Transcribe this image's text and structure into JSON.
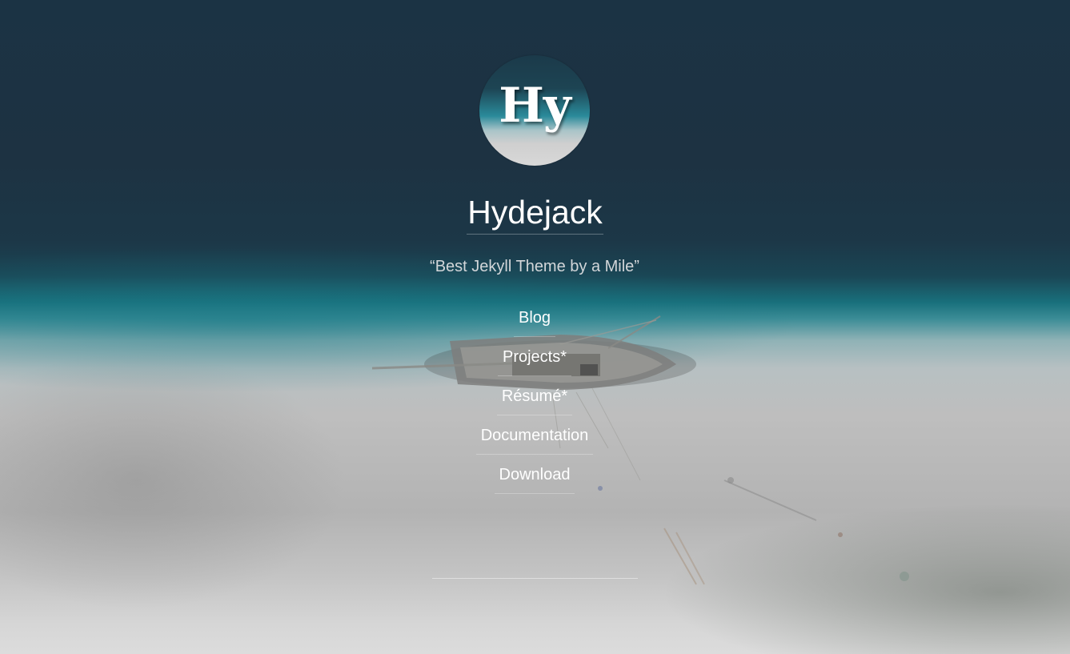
{
  "sidebar": {
    "avatar": {
      "text": "Hy",
      "alt": "Hydejack logo"
    },
    "title": "Hydejack",
    "tagline": "“Best Jekyll Theme by a Mile”",
    "nav": [
      {
        "label": "Blog"
      },
      {
        "label": "Projects*"
      },
      {
        "label": "Résumé*"
      },
      {
        "label": "Documentation"
      },
      {
        "label": "Download"
      }
    ]
  },
  "colors": {
    "background_top": "#1b3344",
    "background_teal": "#19707c",
    "background_sand": "#bebebe",
    "text": "#ffffff",
    "tagline": "#d2d6d9"
  }
}
